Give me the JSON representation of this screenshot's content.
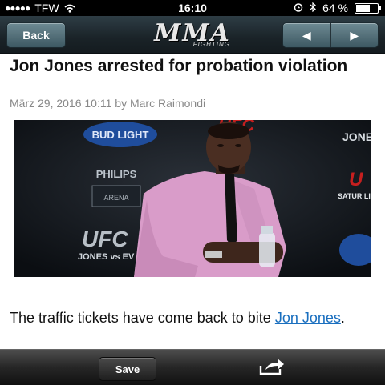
{
  "status_bar": {
    "signal": "●●●●●",
    "carrier": "TFW",
    "time": "16:10",
    "battery_text": "64 %",
    "battery_level": 0.64
  },
  "nav": {
    "back_label": "Back",
    "logo_text": "MMA",
    "logo_subtext": "FIGHTING",
    "prev_label": "◀",
    "next_label": "▶"
  },
  "article": {
    "title": "Jon Jones arrested for probation violation",
    "date": "März 29, 2016 10:11",
    "by": "by",
    "author": "Marc Raimondi",
    "body_before": "The traffic tickets have come back to bite ",
    "body_link": "Jon Jones",
    "body_after": "."
  },
  "photo_text": {
    "bud_light": "BUD LIGHT",
    "ufc_top": "UFC",
    "philips": "PHILIPS",
    "arena": "ARENA",
    "ufc_bottom": "UFC",
    "jones_ev": "JONES vs EV",
    "jone": "JONE",
    "u_right": "U",
    "satur_live": "SATUR LIVE ON"
  },
  "toolbar": {
    "save_label": "Save"
  }
}
